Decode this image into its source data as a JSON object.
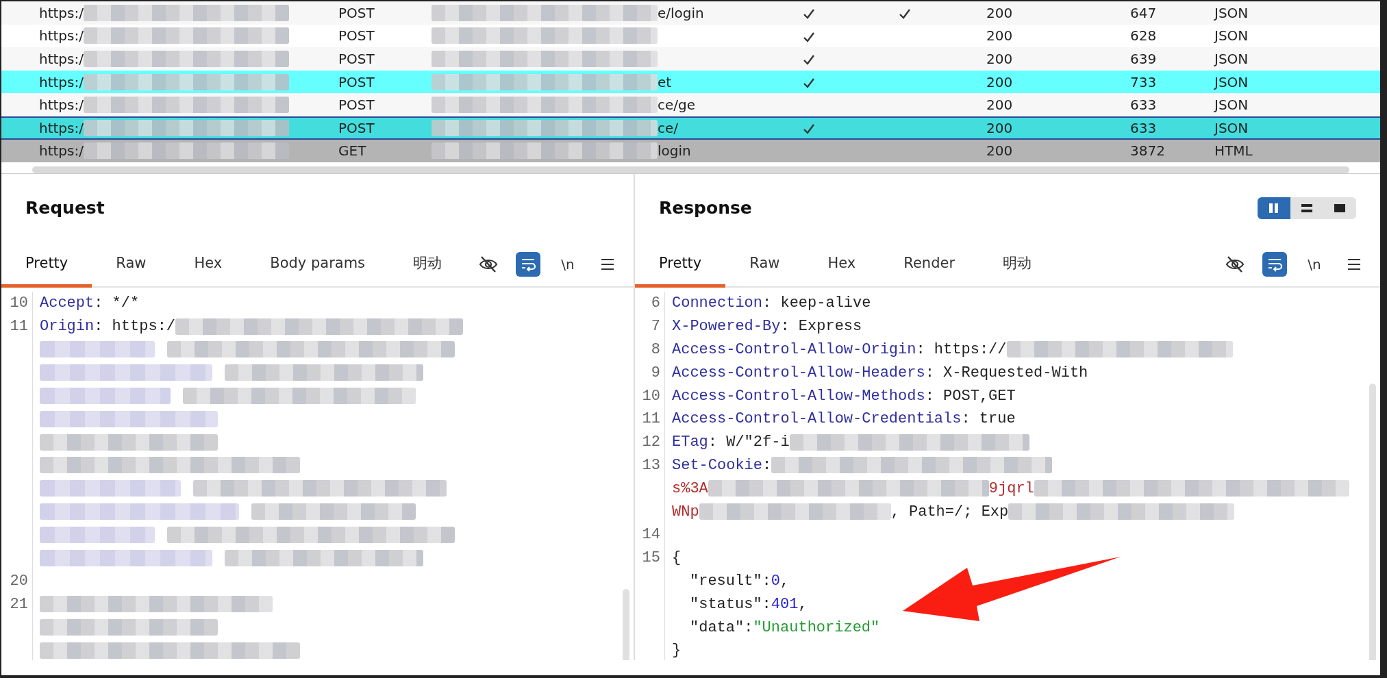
{
  "table": {
    "rows": [
      {
        "host": [
          {
            "kind": "text",
            "s": "https:/"
          },
          {
            "kind": "redacted"
          }
        ],
        "method": "POST",
        "url": [
          {
            "kind": "redacted"
          },
          {
            "kind": "text",
            "s": "e/login"
          }
        ],
        "check_1": true,
        "check_2": true,
        "status": "200",
        "length": "647",
        "mime": "JSON",
        "selected": false
      },
      {
        "host": [
          {
            "kind": "text",
            "s": "https:/"
          },
          {
            "kind": "redacted"
          }
        ],
        "method": "POST",
        "url": [
          {
            "kind": "redacted"
          }
        ],
        "check_1": true,
        "check_2": false,
        "status": "200",
        "length": "628",
        "mime": "JSON",
        "selected": false
      },
      {
        "host": [
          {
            "kind": "text",
            "s": "https:/"
          },
          {
            "kind": "redacted"
          }
        ],
        "method": "POST",
        "url": [
          {
            "kind": "redacted"
          }
        ],
        "check_1": true,
        "check_2": false,
        "status": "200",
        "length": "639",
        "mime": "JSON",
        "selected": false
      },
      {
        "host": [
          {
            "kind": "text",
            "s": "https:/"
          },
          {
            "kind": "redacted"
          }
        ],
        "method": "POST",
        "url": [
          {
            "kind": "redacted"
          },
          {
            "kind": "text",
            "s": "et"
          }
        ],
        "check_1": true,
        "check_2": false,
        "status": "200",
        "length": "733",
        "mime": "JSON",
        "selected": false,
        "color": "#66ffff"
      },
      {
        "host": [
          {
            "kind": "text",
            "s": "https:/"
          },
          {
            "kind": "redacted"
          }
        ],
        "method": "POST",
        "url": [
          {
            "kind": "redacted"
          },
          {
            "kind": "text",
            "s": "ce/ge"
          }
        ],
        "check_1": false,
        "check_2": false,
        "status": "200",
        "length": "633",
        "mime": "JSON",
        "selected": false
      },
      {
        "host": [
          {
            "kind": "text",
            "s": "https:/"
          },
          {
            "kind": "redacted"
          }
        ],
        "method": "POST",
        "url": [
          {
            "kind": "redacted"
          },
          {
            "kind": "text",
            "s": "ce/"
          }
        ],
        "check_1": true,
        "check_2": false,
        "status": "200",
        "length": "633",
        "mime": "JSON",
        "selected": true,
        "color": "#44dddd"
      },
      {
        "host": [
          {
            "kind": "text",
            "s": "https:/"
          },
          {
            "kind": "redacted"
          }
        ],
        "method": "GET",
        "url": [
          {
            "kind": "redacted"
          },
          {
            "kind": "text",
            "s": "login"
          }
        ],
        "check_1": false,
        "check_2": false,
        "status": "200",
        "length": "3872",
        "mime": "HTML",
        "selected": false,
        "color": "#b4b4b4"
      }
    ]
  },
  "request": {
    "title": "Request",
    "tabs": [
      {
        "label": "Pretty",
        "selected": true
      },
      {
        "label": "Raw",
        "selected": false
      },
      {
        "label": "Hex",
        "selected": false
      },
      {
        "label": "Body params",
        "selected": false
      },
      {
        "label": "明动",
        "selected": false
      }
    ],
    "wrap_on": true,
    "newline_label": "\\n",
    "lines": [
      {
        "number": "10",
        "segments": [
          {
            "kind": "key",
            "s": "Accept"
          },
          {
            "kind": "plain",
            "s": ": */*"
          }
        ]
      },
      {
        "number": "11",
        "segments": [
          {
            "kind": "key",
            "s": "Origin"
          },
          {
            "kind": "plain",
            "s": ": https:/"
          },
          {
            "kind": "redacted"
          }
        ]
      },
      {
        "segments": [
          {
            "kind": "redacted-key"
          },
          {
            "kind": "redacted"
          }
        ]
      },
      {
        "segments": [
          {
            "kind": "redacted-key"
          },
          {
            "kind": "redacted"
          }
        ]
      },
      {
        "segments": [
          {
            "kind": "redacted-key"
          },
          {
            "kind": "redacted"
          }
        ]
      },
      {
        "segments": [
          {
            "kind": "redacted-key"
          }
        ]
      },
      {
        "segments": [
          {
            "kind": "redacted"
          }
        ]
      },
      {
        "segments": [
          {
            "kind": "redacted"
          }
        ]
      },
      {
        "segments": [
          {
            "kind": "redacted-key"
          },
          {
            "kind": "redacted"
          }
        ]
      },
      {
        "segments": [
          {
            "kind": "redacted-key"
          },
          {
            "kind": "redacted"
          }
        ]
      },
      {
        "segments": [
          {
            "kind": "redacted-key"
          },
          {
            "kind": "redacted"
          }
        ]
      },
      {
        "segments": [
          {
            "kind": "redacted-key"
          },
          {
            "kind": "redacted"
          }
        ]
      },
      {
        "number": "20"
      },
      {
        "number": "21",
        "segments": [
          {
            "kind": "redacted"
          }
        ]
      },
      {
        "segments": [
          {
            "kind": "redacted"
          }
        ]
      },
      {
        "segments": [
          {
            "kind": "redacted"
          }
        ]
      }
    ]
  },
  "response": {
    "title": "Response",
    "layout_buttons": [
      {
        "selected": true
      },
      {
        "selected": false
      },
      {
        "selected": false
      }
    ],
    "tabs": [
      {
        "label": "Pretty",
        "selected": true
      },
      {
        "label": "Raw",
        "selected": false
      },
      {
        "label": "Hex",
        "selected": false
      },
      {
        "label": "Render",
        "selected": false
      },
      {
        "label": "明动",
        "selected": false
      }
    ],
    "wrap_on": true,
    "newline_label": "\\n",
    "lines": [
      {
        "number": "6",
        "segments": [
          {
            "kind": "key",
            "s": "Connection"
          },
          {
            "kind": "plain",
            "s": ": keep-alive"
          }
        ]
      },
      {
        "number": "7",
        "segments": [
          {
            "kind": "key",
            "s": "X-Powered-By"
          },
          {
            "kind": "plain",
            "s": ": Express"
          }
        ]
      },
      {
        "number": "8",
        "segments": [
          {
            "kind": "key",
            "s": "Access-Control-Allow-Origin"
          },
          {
            "kind": "plain",
            "s": ": https://"
          },
          {
            "kind": "redacted"
          }
        ]
      },
      {
        "number": "9",
        "segments": [
          {
            "kind": "key",
            "s": "Access-Control-Allow-Headers"
          },
          {
            "kind": "plain",
            "s": ": X-Requested-With"
          }
        ]
      },
      {
        "number": "10",
        "segments": [
          {
            "kind": "key",
            "s": "Access-Control-Allow-Methods"
          },
          {
            "kind": "plain",
            "s": ": POST,GET"
          }
        ]
      },
      {
        "number": "11",
        "segments": [
          {
            "kind": "key",
            "s": "Access-Control-Allow-Credentials"
          },
          {
            "kind": "plain",
            "s": ": true"
          }
        ]
      },
      {
        "number": "12",
        "segments": [
          {
            "kind": "key",
            "s": "ETag"
          },
          {
            "kind": "plain",
            "s": ": W/\"2f-i"
          },
          {
            "kind": "redacted"
          }
        ]
      },
      {
        "number": "13",
        "segments": [
          {
            "kind": "key",
            "s": "Set-Cookie"
          },
          {
            "kind": "plain",
            "s": ":"
          },
          {
            "kind": "redacted"
          }
        ]
      },
      {
        "segments": [
          {
            "kind": "cookie",
            "s": "s%3A"
          },
          {
            "kind": "redacted"
          },
          {
            "kind": "cookie",
            "s": "9jqrl"
          },
          {
            "kind": "redacted"
          }
        ]
      },
      {
        "segments": [
          {
            "kind": "cookie",
            "s": "WNp"
          },
          {
            "kind": "redacted"
          },
          {
            "kind": "plain",
            "s": ", Path=/; Exp"
          },
          {
            "kind": "redacted"
          }
        ]
      },
      {
        "number": "14"
      },
      {
        "number": "15",
        "segments": [
          {
            "kind": "plain",
            "s": "{"
          }
        ]
      },
      {
        "segments": [
          {
            "kind": "indent"
          },
          {
            "kind": "plain",
            "s": "\"result\":"
          },
          {
            "kind": "number",
            "s": "0"
          },
          {
            "kind": "plain",
            "s": ","
          }
        ]
      },
      {
        "segments": [
          {
            "kind": "indent"
          },
          {
            "kind": "plain",
            "s": "\"status\":"
          },
          {
            "kind": "number",
            "s": "401"
          },
          {
            "kind": "plain",
            "s": ","
          }
        ]
      },
      {
        "segments": [
          {
            "kind": "indent"
          },
          {
            "kind": "plain",
            "s": "\"data\":"
          },
          {
            "kind": "string",
            "s": "\"Unauthorized\""
          }
        ]
      },
      {
        "segments": [
          {
            "kind": "plain",
            "s": "}"
          }
        ]
      }
    ]
  }
}
